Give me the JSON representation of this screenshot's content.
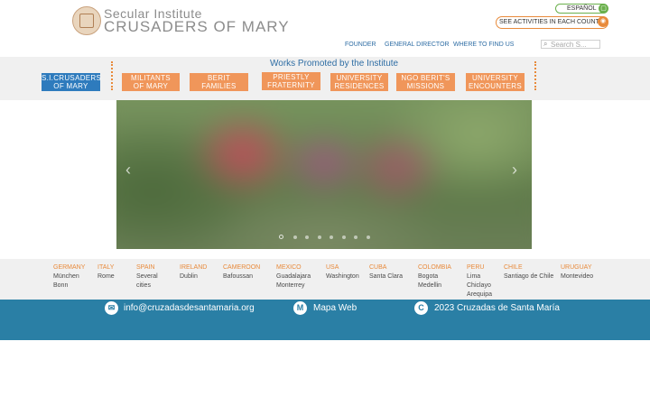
{
  "logo": {
    "line1": "Secular Institute",
    "line2": "CRUSADERS OF MARY"
  },
  "header": {
    "language": "ESPAÑOL",
    "activities": "SEE ACTIVITIES IN EACH COUNTRY",
    "nav": [
      "FOUNDER",
      "GENERAL DIRECTOR",
      "WHERE TO FIND US"
    ],
    "search_placeholder": "Search S..."
  },
  "band": {
    "title": "Works Promoted by the Institute",
    "buttons": [
      {
        "line1": "S.I.CRUSADERS",
        "line2": "OF MARY"
      },
      {
        "line1": "MILITANTS",
        "line2": "OF MARY"
      },
      {
        "line1": "BERIT",
        "line2": "FAMILIES"
      },
      {
        "line1": "PRIESTLY",
        "line2": "FRATERNITY"
      },
      {
        "line1": "UNIVERSITY",
        "line2": "RESIDENCES"
      },
      {
        "line1": "NGO BERIT'S",
        "line2": "MISSIONS"
      },
      {
        "line1": "UNIVERSITY",
        "line2": "ENCOUNTERS"
      }
    ]
  },
  "slider": {
    "prev": "‹",
    "next": "›",
    "dot_count": 8,
    "active_index": 0
  },
  "countries": [
    {
      "name": "GERMANY",
      "cities": [
        "München",
        "Bonn"
      ]
    },
    {
      "name": "ITALY",
      "cities": [
        "Rome"
      ]
    },
    {
      "name": "SPAIN",
      "cities": [
        "Several",
        "cities"
      ]
    },
    {
      "name": "IRELAND",
      "cities": [
        "Dublin"
      ]
    },
    {
      "name": "CAMEROON",
      "cities": [
        "Bafoussan"
      ]
    },
    {
      "name": "MEXICO",
      "cities": [
        "Guadalajara",
        "Monterrey"
      ]
    },
    {
      "name": "USA",
      "cities": [
        "Washington"
      ]
    },
    {
      "name": "CUBA",
      "cities": [
        "Santa Clara"
      ]
    },
    {
      "name": "COLOMBIA",
      "cities": [
        "Bogota",
        "Medellin"
      ]
    },
    {
      "name": "PERU",
      "cities": [
        "Lima",
        "Chiclayo",
        "Arequipa"
      ]
    },
    {
      "name": "CHILE",
      "cities": [
        "Santiago de Chile"
      ]
    },
    {
      "name": "URUGUAY",
      "cities": [
        "Montevideo"
      ]
    }
  ],
  "footer": {
    "email": "info@cruzadasdesantamaria.org",
    "sitemap": "Mapa Web",
    "copyright": "2023 Cruzadas de Santa María",
    "sitemap_icon_letter": "M",
    "copyright_icon_letter": "C"
  },
  "colors": {
    "blue": "#2e6da4",
    "orange": "#f0965a",
    "green": "#6ab04c",
    "footer": "#2a7fa5"
  }
}
